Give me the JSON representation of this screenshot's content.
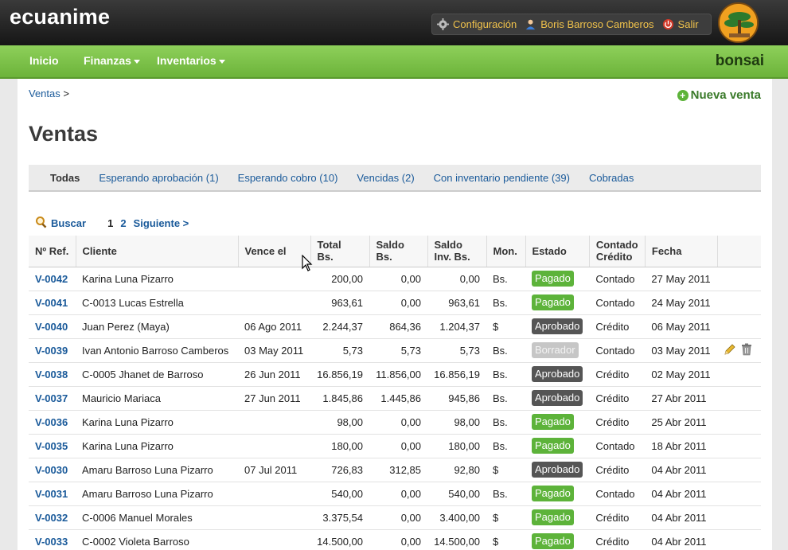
{
  "header": {
    "brand": "ecuanime",
    "config_label": "Configuración",
    "user_label": "Boris Barroso Camberos",
    "logout_label": "Salir"
  },
  "nav": {
    "home": "Inicio",
    "finanzas": "Finanzas",
    "inventarios": "Inventarios",
    "bonsai": "bonsai"
  },
  "breadcrumb": {
    "link": "Ventas",
    "sep": ">"
  },
  "new_sale_label": "Nueva venta",
  "page_title": "Ventas",
  "filters": [
    "Todas",
    "Esperando aprobación (1)",
    "Esperando cobro (10)",
    "Vencidas (2)",
    "Con inventario pendiente (39)",
    "Cobradas"
  ],
  "pager": {
    "search": "Buscar",
    "pages": [
      "1",
      "2"
    ],
    "next": "Siguiente >"
  },
  "table": {
    "headers": {
      "ref": "Nº Ref.",
      "cliente": "Cliente",
      "vence": "Vence el",
      "total1": "Total",
      "total2": "Bs.",
      "saldo1": "Saldo",
      "saldo2": "Bs.",
      "inv1": "Saldo",
      "inv2": "Inv. Bs.",
      "mon": "Mon.",
      "estado": "Estado",
      "cc1": "Contado",
      "cc2": "Crédito",
      "fecha": "Fecha"
    },
    "rows": [
      {
        "ref": "V-0042",
        "cliente": "Karina Luna Pizarro",
        "vence": "",
        "total": "200,00",
        "saldo": "0,00",
        "inv": "0,00",
        "mon": "Bs.",
        "estado": "Pagado",
        "tipo": "Contado",
        "fecha": "27 May 2011"
      },
      {
        "ref": "V-0041",
        "cliente": "C-0013 Lucas Estrella",
        "vence": "",
        "total": "963,61",
        "saldo": "0,00",
        "inv": "963,61",
        "mon": "Bs.",
        "estado": "Pagado",
        "tipo": "Contado",
        "fecha": "24 May 2011"
      },
      {
        "ref": "V-0040",
        "cliente": "Juan Perez (Maya)",
        "vence": "06 Ago 2011",
        "total": "2.244,37",
        "saldo": "864,36",
        "inv": "1.204,37",
        "mon": "$",
        "estado": "Aprobado",
        "tipo": "Crédito",
        "fecha": "06 May 2011"
      },
      {
        "ref": "V-0039",
        "cliente": "Ivan Antonio Barroso Camberos",
        "vence": "03 May 2011",
        "total": "5,73",
        "saldo": "5,73",
        "inv": "5,73",
        "mon": "Bs.",
        "estado": "Borrador",
        "tipo": "Contado",
        "fecha": "03 May 2011"
      },
      {
        "ref": "V-0038",
        "cliente": "C-0005 Jhanet de Barroso",
        "vence": "26 Jun 2011",
        "total": "16.856,19",
        "saldo": "11.856,00",
        "inv": "16.856,19",
        "mon": "Bs.",
        "estado": "Aprobado",
        "tipo": "Crédito",
        "fecha": "02 May 2011"
      },
      {
        "ref": "V-0037",
        "cliente": "Mauricio Mariaca",
        "vence": "27 Jun 2011",
        "total": "1.845,86",
        "saldo": "1.445,86",
        "inv": "945,86",
        "mon": "Bs.",
        "estado": "Aprobado",
        "tipo": "Crédito",
        "fecha": "27 Abr 2011"
      },
      {
        "ref": "V-0036",
        "cliente": "Karina Luna Pizarro",
        "vence": "",
        "total": "98,00",
        "saldo": "0,00",
        "inv": "98,00",
        "mon": "Bs.",
        "estado": "Pagado",
        "tipo": "Crédito",
        "fecha": "25 Abr 2011"
      },
      {
        "ref": "V-0035",
        "cliente": "Karina Luna Pizarro",
        "vence": "",
        "total": "180,00",
        "saldo": "0,00",
        "inv": "180,00",
        "mon": "Bs.",
        "estado": "Pagado",
        "tipo": "Contado",
        "fecha": "18 Abr 2011"
      },
      {
        "ref": "V-0030",
        "cliente": "Amaru Barroso Luna Pizarro",
        "vence": "07 Jul 2011",
        "total": "726,83",
        "saldo": "312,85",
        "inv": "92,80",
        "mon": "$",
        "estado": "Aprobado",
        "tipo": "Crédito",
        "fecha": "04 Abr 2011"
      },
      {
        "ref": "V-0031",
        "cliente": "Amaru Barroso Luna Pizarro",
        "vence": "",
        "total": "540,00",
        "saldo": "0,00",
        "inv": "540,00",
        "mon": "Bs.",
        "estado": "Pagado",
        "tipo": "Contado",
        "fecha": "04 Abr 2011"
      },
      {
        "ref": "V-0032",
        "cliente": "C-0006 Manuel Morales",
        "vence": "",
        "total": "3.375,54",
        "saldo": "0,00",
        "inv": "3.400,00",
        "mon": "$",
        "estado": "Pagado",
        "tipo": "Crédito",
        "fecha": "04 Abr 2011"
      },
      {
        "ref": "V-0033",
        "cliente": "C-0002 Violeta Barroso",
        "vence": "",
        "total": "14.500,00",
        "saldo": "0,00",
        "inv": "14.500,00",
        "mon": "$",
        "estado": "Pagado",
        "tipo": "Crédito",
        "fecha": "04 Abr 2011"
      }
    ]
  },
  "colors": {
    "green_nav": "#7cc24a",
    "link": "#1a5a9a",
    "badge_pagado": "#5db33a",
    "badge_aprobado": "#555555",
    "badge_borrador": "#c6c6c6",
    "header_gold": "#f0c24b"
  },
  "icons": [
    "gear-icon",
    "user-icon",
    "power-icon",
    "bonsai-logo",
    "plus-circle-icon",
    "magnifier-icon",
    "pencil-icon",
    "trash-icon",
    "mouse-cursor-icon"
  ]
}
